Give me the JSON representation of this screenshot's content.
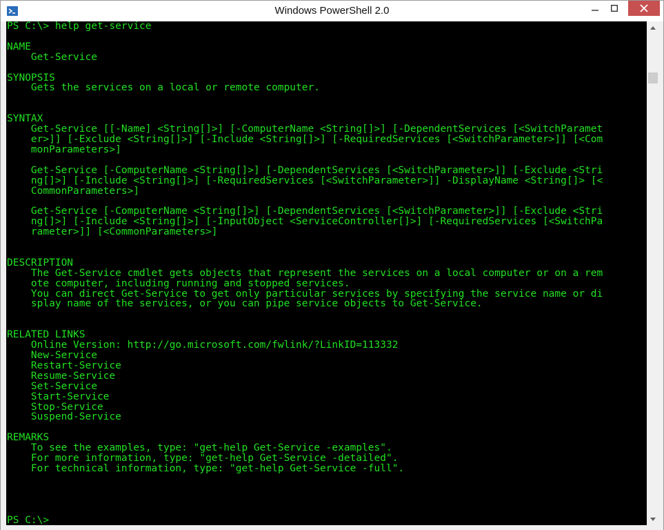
{
  "window": {
    "title": "Windows PowerShell 2.0",
    "app_icon": "powershell-icon",
    "accent_color": "#1e73be",
    "close_color": "#c75050"
  },
  "console": {
    "text_color": "#22e022",
    "background": "#000000",
    "lines": [
      "PS C:\\> help get-service",
      "",
      "NAME",
      "    Get-Service",
      "",
      "SYNOPSIS",
      "    Gets the services on a local or remote computer.",
      "",
      "",
      "SYNTAX",
      "    Get-Service [[-Name] <String[]>] [-ComputerName <String[]>] [-DependentServices [<SwitchParamet",
      "    er>]] [-Exclude <String[]>] [-Include <String[]>] [-RequiredServices [<SwitchParameter>]] [<Com",
      "    monParameters>]",
      "",
      "    Get-Service [-ComputerName <String[]>] [-DependentServices [<SwitchParameter>]] [-Exclude <Stri",
      "    ng[]>] [-Include <String[]>] [-RequiredServices [<SwitchParameter>]] -DisplayName <String[]> [<",
      "    CommonParameters>]",
      "",
      "    Get-Service [-ComputerName <String[]>] [-DependentServices [<SwitchParameter>]] [-Exclude <Stri",
      "    ng[]>] [-Include <String[]>] [-InputObject <ServiceController[]>] [-RequiredServices [<SwitchPa",
      "    rameter>]] [<CommonParameters>]",
      "",
      "",
      "DESCRIPTION",
      "    The Get-Service cmdlet gets objects that represent the services on a local computer or on a rem",
      "    ote computer, including running and stopped services.",
      "    You can direct Get-Service to get only particular services by specifying the service name or di",
      "    splay name of the services, or you can pipe service objects to Get-Service.",
      "",
      "",
      "RELATED LINKS",
      "    Online Version: http://go.microsoft.com/fwlink/?LinkID=113332",
      "    New-Service",
      "    Restart-Service",
      "    Resume-Service",
      "    Set-Service",
      "    Start-Service",
      "    Stop-Service",
      "    Suspend-Service",
      "",
      "REMARKS",
      "    To see the examples, type: \"get-help Get-Service -examples\".",
      "    For more information, type: \"get-help Get-Service -detailed\".",
      "    For technical information, type: \"get-help Get-Service -full\".",
      "",
      "",
      "",
      "",
      "PS C:\\>"
    ]
  },
  "scrollbar": {
    "up_icon": "scroll-up-arrow-icon",
    "down_icon": "scroll-down-arrow-icon"
  },
  "caption_buttons": {
    "minimize_icon": "minimize-icon",
    "maximize_icon": "maximize-icon",
    "close_icon": "close-icon"
  }
}
